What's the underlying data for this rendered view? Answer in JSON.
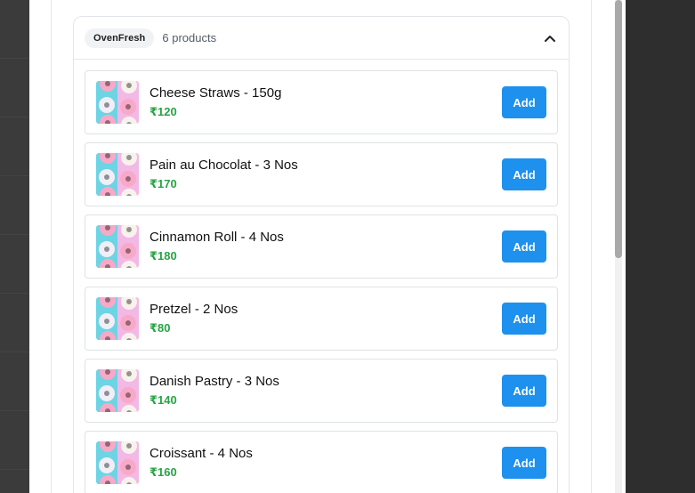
{
  "group": {
    "brand": "OvenFresh",
    "count_label": "6 products",
    "collapse_icon": "chevron-up-icon"
  },
  "products": [
    {
      "name": "Cheese Straws - 150g",
      "price": "₹120",
      "button": "Add"
    },
    {
      "name": "Pain au Chocolat - 3 Nos",
      "price": "₹170",
      "button": "Add"
    },
    {
      "name": "Cinnamon Roll - 4 Nos",
      "price": "₹180",
      "button": "Add"
    },
    {
      "name": "Pretzel - 2 Nos",
      "price": "₹80",
      "button": "Add"
    },
    {
      "name": "Danish Pastry - 3 Nos",
      "price": "₹140",
      "button": "Add"
    },
    {
      "name": "Croissant - 4 Nos",
      "price": "₹160",
      "button": "Add"
    }
  ],
  "colors": {
    "accent": "#1e90ee",
    "price": "#27a444"
  }
}
